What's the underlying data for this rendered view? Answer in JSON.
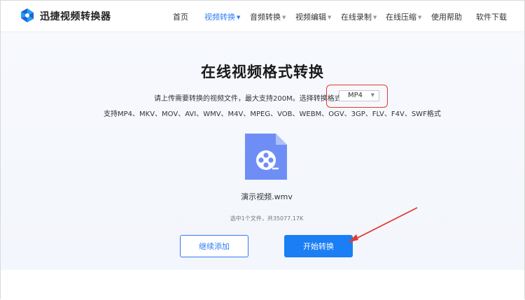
{
  "header": {
    "brand": "迅捷视频转换器",
    "nav": [
      {
        "label": "首页",
        "has_caret": false,
        "active": false
      },
      {
        "label": "视频转换",
        "has_caret": true,
        "active": true
      },
      {
        "label": "音频转换",
        "has_caret": true,
        "active": false
      },
      {
        "label": "视频编辑",
        "has_caret": true,
        "active": false
      },
      {
        "label": "在线录制",
        "has_caret": true,
        "active": false
      },
      {
        "label": "在线压缩",
        "has_caret": true,
        "active": false
      },
      {
        "label": "使用帮助",
        "has_caret": false,
        "active": false
      },
      {
        "label": "软件下载",
        "has_caret": false,
        "active": false
      }
    ]
  },
  "main": {
    "title": "在线视频格式转换",
    "upload_hint": "请上传需要转换的视频文件，最大支持200M。选择转换格式：",
    "format_select": {
      "value": "MP4"
    },
    "supported_formats": "支持MP4、MKV、MOV、AVI、WMV、M4V、MPEG、VOB、WEBM、OGV、3GP、FLV、F4V、SWF格式",
    "file": {
      "name": "演示视频.wmv",
      "icon": "video-file-icon"
    },
    "file_count": "选中1个文件，共35077.17K",
    "add_button": "继续添加",
    "start_button": "开始转换"
  },
  "colors": {
    "accent": "#2e7cf6",
    "primary_button": "#1a7ef5",
    "annotation_red": "#e23b2e",
    "file_icon": "#6f8ef5"
  }
}
